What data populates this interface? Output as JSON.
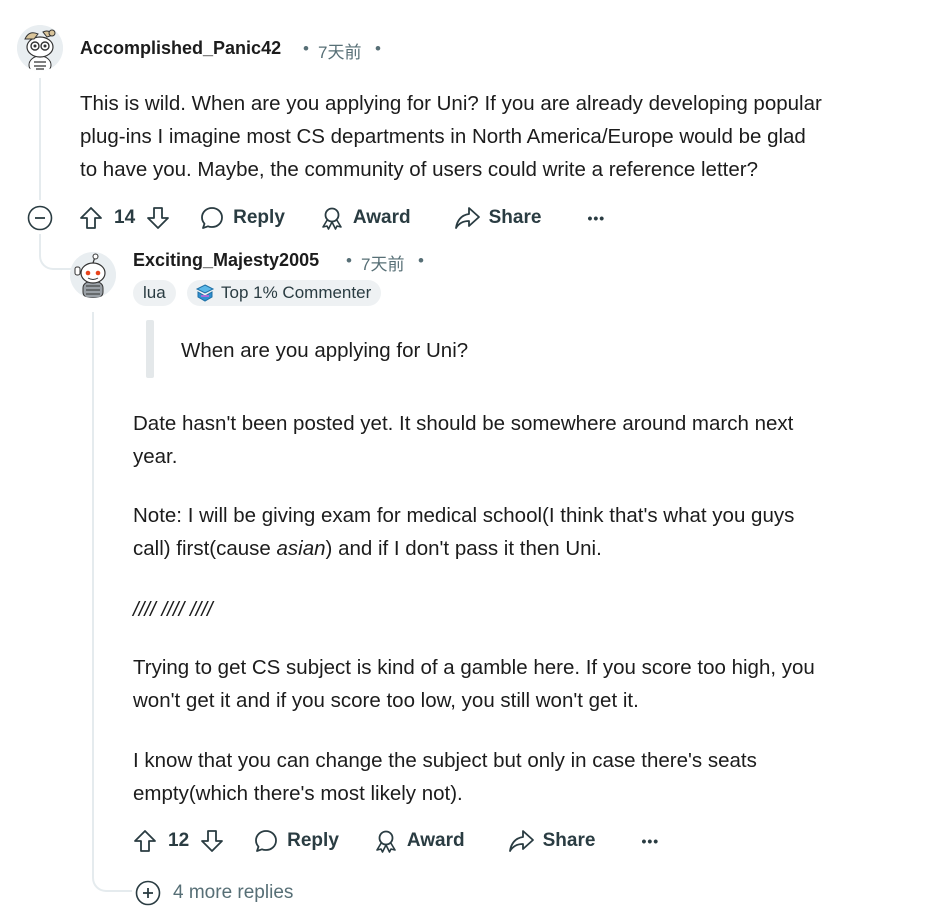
{
  "comment1": {
    "username": "Accomplished_Panic42",
    "separator": "•",
    "time": "7天前",
    "trailing_dot": "•",
    "body_lines": [
      "This is wild. When are you applying for Uni? If you are already developing popular",
      "plug-ins I imagine most CS departments in North America/Europe would be glad",
      "to have you. Maybe, the community of users could write a reference letter?"
    ],
    "votes": "14",
    "reply_label": "Reply",
    "award_label": "Award",
    "share_label": "Share",
    "more_label": "•••"
  },
  "comment2": {
    "username": "Exciting_Majesty2005",
    "separator": "•",
    "time": "7天前",
    "trailing_dot": "•",
    "flair_user": "lua",
    "badge_label": "Top 1% Commenter",
    "quote": "When are you applying for Uni?",
    "p1_lines": [
      "Date hasn't been posted yet. It should be somewhere around march next",
      "year."
    ],
    "p2_line1": "Note: I will be giving exam for medical school(I think that's what you guys",
    "p2_line2_a": "call) first(cause ",
    "p2_line2_em": "asian",
    "p2_line2_b": ") and if I don't pass it then Uni.",
    "p3": "//// //// ////",
    "p4_lines": [
      "Trying to get CS subject is kind of a gamble here. If you score too high, you",
      "won't get it and if you score too low, you still won't get it."
    ],
    "p5_lines": [
      "I know that you can change the subject but only in case there's seats",
      "empty(which there's most likely not)."
    ],
    "votes": "12",
    "reply_label": "Reply",
    "award_label": "Award",
    "share_label": "Share",
    "more_label": "•••"
  },
  "more_replies": {
    "label": "4 more replies"
  },
  "colors": {
    "text": "#1c1c1c",
    "meta": "#576f76",
    "action": "#2a3c42",
    "thread_line": "#e5ebee",
    "flair_bg": "#eef1f3"
  }
}
